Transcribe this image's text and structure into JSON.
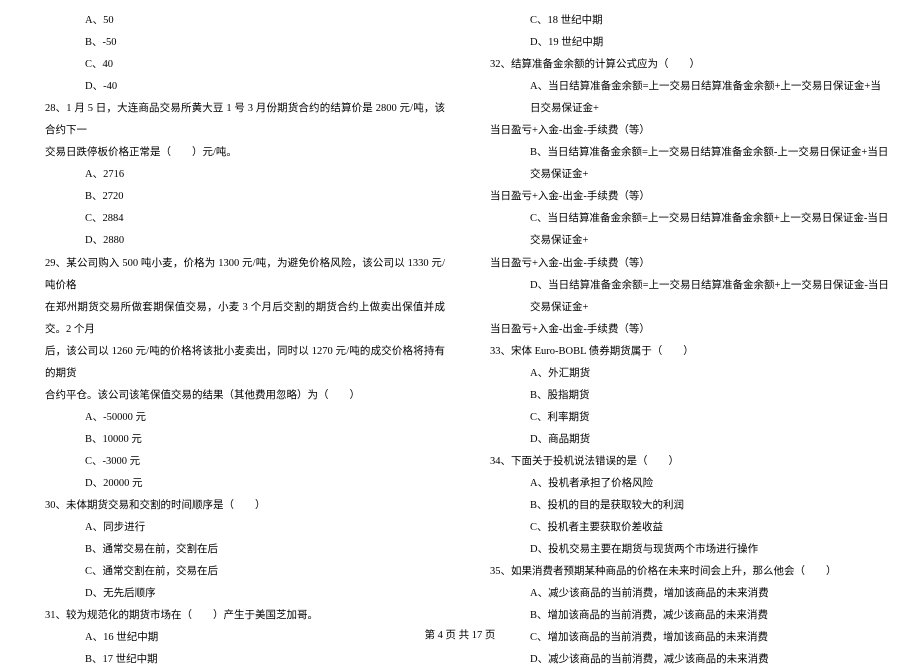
{
  "left": {
    "q27_opts": {
      "a": "A、50",
      "b": "B、-50",
      "c": "C、40",
      "d": "D、-40"
    },
    "q28": {
      "line1": "28、1 月 5 日，大连商品交易所黄大豆 1 号 3 月份期货合约的结算价是 2800 元/吨，该合约下一",
      "line2": "交易日跌停板价格正常是（　　）元/吨。",
      "a": "A、2716",
      "b": "B、2720",
      "c": "C、2884",
      "d": "D、2880"
    },
    "q29": {
      "line1": "29、某公司购入 500 吨小麦，价格为 1300 元/吨，为避免价格风险，该公司以 1330 元/吨价格",
      "line2": "在郑州期货交易所做套期保值交易，小麦 3 个月后交割的期货合约上做卖出保值并成交。2 个月",
      "line3": "后，该公司以 1260 元/吨的价格将该批小麦卖出，同时以 1270 元/吨的成交价格将持有的期货",
      "line4": "合约平仓。该公司该笔保值交易的结果（其他费用忽略）为（　　）",
      "a": "A、-50000 元",
      "b": "B、10000 元",
      "c": "C、-3000 元",
      "d": "D、20000 元"
    },
    "q30": {
      "line1": "30、未体期货交易和交割的时间顺序是（　　）",
      "a": "A、同步进行",
      "b": "B、通常交易在前，交割在后",
      "c": "C、通常交割在前，交易在后",
      "d": "D、无先后顺序"
    },
    "q31": {
      "line1": "31、较为规范化的期货市场在（　　）产生于美国芝加哥。",
      "a": "A、16 世纪中期",
      "b": "B、17 世纪中期"
    }
  },
  "right": {
    "q31_opts": {
      "c": "C、18 世纪中期",
      "d": "D、19 世纪中期"
    },
    "q32": {
      "line1": "32、结算准备金余额的计算公式应为（　　）",
      "a1": "A、当日结算准备金余额=上一交易日结算准备金余额+上一交易日保证金+当日交易保证金+",
      "a2": "当日盈亏+入金-出金-手续费（等）",
      "b1": "B、当日结算准备金余额=上一交易日结算准备金余额-上一交易日保证金+当日交易保证金+",
      "b2": "当日盈亏+入金-出金-手续费（等）",
      "c1": "C、当日结算准备金余额=上一交易日结算准备金余额+上一交易日保证金-当日交易保证金+",
      "c2": "当日盈亏+入金-出金-手续费（等）",
      "d1": "D、当日结算准备金余额=上一交易日结算准备金余额+上一交易日保证金-当日交易保证金+",
      "d2": "当日盈亏+入金-出金-手续费（等）"
    },
    "q33": {
      "line1": "33、宋体 Euro-BOBL 债券期货属于（　　）",
      "a": "A、外汇期货",
      "b": "B、股指期货",
      "c": "C、利率期货",
      "d": "D、商品期货"
    },
    "q34": {
      "line1": "34、下面关于投机说法错误的是（　　）",
      "a": "A、投机者承担了价格风险",
      "b": "B、投机的目的是获取较大的利润",
      "c": "C、投机者主要获取价差收益",
      "d": "D、投机交易主要在期货与现货两个市场进行操作"
    },
    "q35": {
      "line1": "35、如果消费者预期某种商品的价格在未来时间会上升，那么他会（　　）",
      "a": "A、减少该商品的当前消费，增加该商品的未来消费",
      "b": "B、增加该商品的当前消费，减少该商品的未来消费",
      "c": "C、增加该商品的当前消费，增加该商品的未来消费",
      "d": "D、减少该商品的当前消费，减少该商品的未来消费"
    }
  },
  "footer": "第 4 页 共 17 页"
}
